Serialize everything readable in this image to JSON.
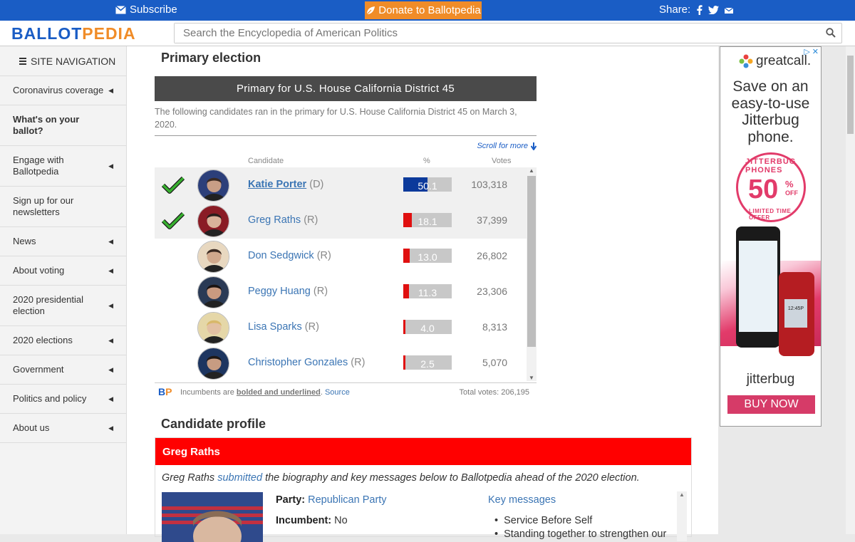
{
  "topbar": {
    "subscribe": "Subscribe",
    "donate": "Donate to Ballotpedia",
    "share": "Share:"
  },
  "header": {
    "logo_part1": "BALLOT",
    "logo_part2": "PEDIA",
    "search_placeholder": "Search the Encyclopedia of American Politics"
  },
  "sidebar": {
    "title": "SITE NAVIGATION",
    "items": [
      {
        "label": "Coronavirus coverage",
        "caret": true
      },
      {
        "label": "What's on your ballot?",
        "caret": false
      },
      {
        "label": "Engage with Ballotpedia",
        "caret": true
      },
      {
        "label": "Sign up for our newsletters",
        "caret": false
      },
      {
        "label": "News",
        "caret": true
      },
      {
        "label": "About voting",
        "caret": true
      },
      {
        "label": "2020 presidential election",
        "caret": true
      },
      {
        "label": "2020 elections",
        "caret": true
      },
      {
        "label": "Government",
        "caret": true
      },
      {
        "label": "Politics and policy",
        "caret": true
      },
      {
        "label": "About us",
        "caret": true
      }
    ]
  },
  "primary": {
    "heading": "Primary election",
    "race_title": "Primary for U.S. House California District 45",
    "description": "The following candidates ran in the primary for U.S. House California District 45 on March 3, 2020.",
    "scroll_hint": "Scroll for more",
    "col_candidate": "Candidate",
    "col_pct": "%",
    "col_votes": "Votes",
    "footer_incumbents_pre": "Incumbents are",
    "footer_incumbents_bold": "bolded and underlined",
    "footer_source": "Source",
    "footer_total": "Total votes: 206,195",
    "candidates": [
      {
        "name": "Katie Porter",
        "party": "(D)",
        "pct": "50.1",
        "pct_value": 50.1,
        "votes": "103,318",
        "winner": true,
        "incumbent": true,
        "color": "#0c3a9b"
      },
      {
        "name": "Greg Raths",
        "party": "(R)",
        "pct": "18.1",
        "pct_value": 18.1,
        "votes": "37,399",
        "winner": true,
        "incumbent": false,
        "color": "#e01010"
      },
      {
        "name": "Don Sedgwick",
        "party": "(R)",
        "pct": "13.0",
        "pct_value": 13.0,
        "votes": "26,802",
        "winner": false,
        "incumbent": false,
        "color": "#e01010"
      },
      {
        "name": "Peggy Huang",
        "party": "(R)",
        "pct": "11.3",
        "pct_value": 11.3,
        "votes": "23,306",
        "winner": false,
        "incumbent": false,
        "color": "#e01010"
      },
      {
        "name": "Lisa Sparks",
        "party": "(R)",
        "pct": "4.0",
        "pct_value": 4.0,
        "votes": "8,313",
        "winner": false,
        "incumbent": false,
        "color": "#e01010"
      },
      {
        "name": "Christopher Gonzales",
        "party": "(R)",
        "pct": "2.5",
        "pct_value": 2.5,
        "votes": "5,070",
        "winner": false,
        "incumbent": false,
        "color": "#e01010"
      }
    ]
  },
  "profile": {
    "heading": "Candidate profile",
    "name": "Greg Raths",
    "intro_pre": "Greg Raths",
    "intro_link": "submitted",
    "intro_post": "the biography and key messages below to Ballotpedia ahead of the 2020 election.",
    "party_label": "Party:",
    "party_value": "Republican Party",
    "incumbent_label": "Incumbent:",
    "incumbent_value": "No",
    "key_messages_title": "Key messages",
    "key_messages": [
      "Service Before Self",
      "Standing together to strengthen our"
    ]
  },
  "ad": {
    "brand_top": "greatcall.",
    "headline": "Save on an easy-to-use Jitterbug phone.",
    "badge_arc": "JITTERBUG PHONES",
    "badge_num": "50",
    "badge_pct": "%",
    "badge_off": "OFF",
    "badge_sub": "LIMITED TIME OFFER",
    "phone_time": "12:45P",
    "brand_bottom": "jitterbug",
    "cta": "BUY NOW"
  },
  "colors": {
    "topbar": "#1a5dc5",
    "donate": "#f08c28",
    "democrat": "#0c3a9b",
    "republican": "#e01010",
    "profile_header": "#ff0000",
    "ad_pink": "#d63b68"
  }
}
